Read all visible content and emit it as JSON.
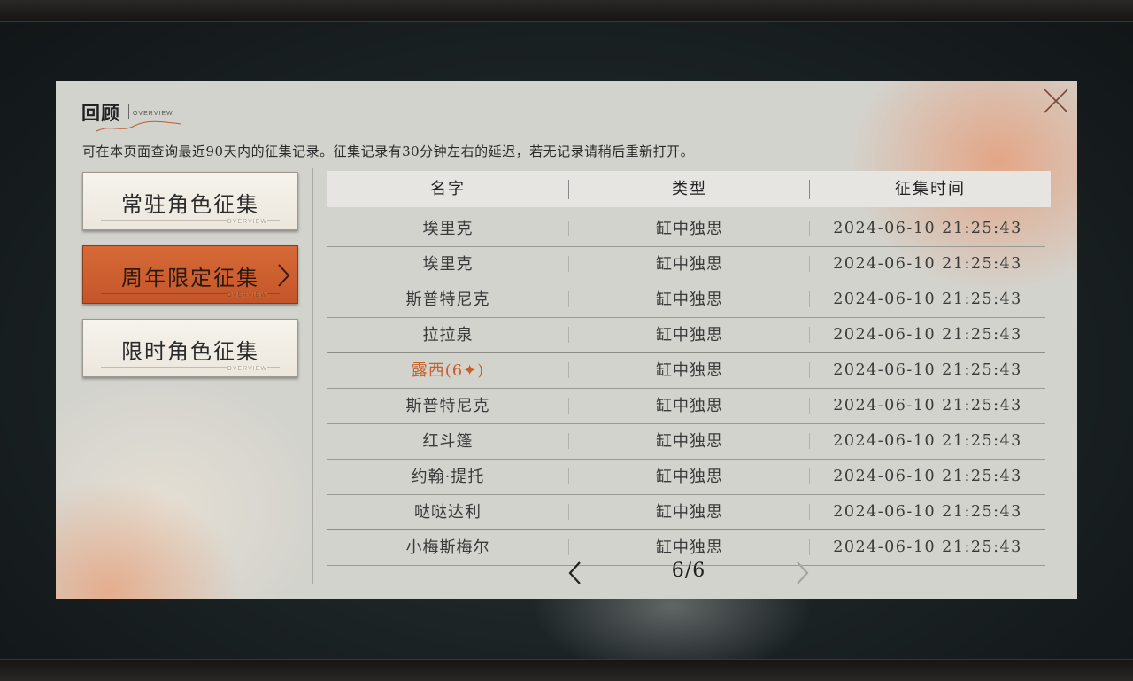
{
  "panel": {
    "title": "回顾",
    "title_sub": "OVERVIEW",
    "subtitle": "可在本页面查询最近90天内的征集记录。征集记录有30分钟左右的延迟，若无记录请稍后重新打开。"
  },
  "tabs": [
    {
      "label": "常驻角色征集",
      "deco": "OVERVIEW",
      "selected": false
    },
    {
      "label": "周年限定征集",
      "deco": "OVERVIEW",
      "selected": true
    },
    {
      "label": "限时角色征集",
      "deco": "OVERVIEW",
      "selected": false
    }
  ],
  "table": {
    "headers": [
      "名字",
      "类型",
      "征集时间"
    ],
    "rows": [
      {
        "name": "埃里克",
        "type": "缸中独思",
        "time": "2024-06-10 21:25:43"
      },
      {
        "name": "埃里克",
        "type": "缸中独思",
        "time": "2024-06-10 21:25:43"
      },
      {
        "name": "斯普特尼克",
        "type": "缸中独思",
        "time": "2024-06-10 21:25:43"
      },
      {
        "name": "拉拉泉",
        "type": "缸中独思",
        "time": "2024-06-10 21:25:43"
      },
      {
        "name": "露西(6✦)",
        "type": "缸中独思",
        "time": "2024-06-10 21:25:43"
      },
      {
        "name": "斯普特尼克",
        "type": "缸中独思",
        "time": "2024-06-10 21:25:43"
      },
      {
        "name": "红斗篷",
        "type": "缸中独思",
        "time": "2024-06-10 21:25:43"
      },
      {
        "name": "约翰·提托",
        "type": "缸中独思",
        "time": "2024-06-10 21:25:43"
      },
      {
        "name": "哒哒达利",
        "type": "缸中独思",
        "time": "2024-06-10 21:25:43"
      },
      {
        "name": "小梅斯梅尔",
        "type": "缸中独思",
        "time": "2024-06-10 21:25:43"
      }
    ]
  },
  "pager": {
    "text": "6/6"
  },
  "icons": {
    "close": "close-icon",
    "prev": "chevron-left-icon",
    "next": "chevron-right-icon",
    "tab_arrow": "chevron-right-icon"
  },
  "colors": {
    "accent": "#c4552a",
    "highlight_text": "#c8602a",
    "panel": "#d3d3cd"
  }
}
